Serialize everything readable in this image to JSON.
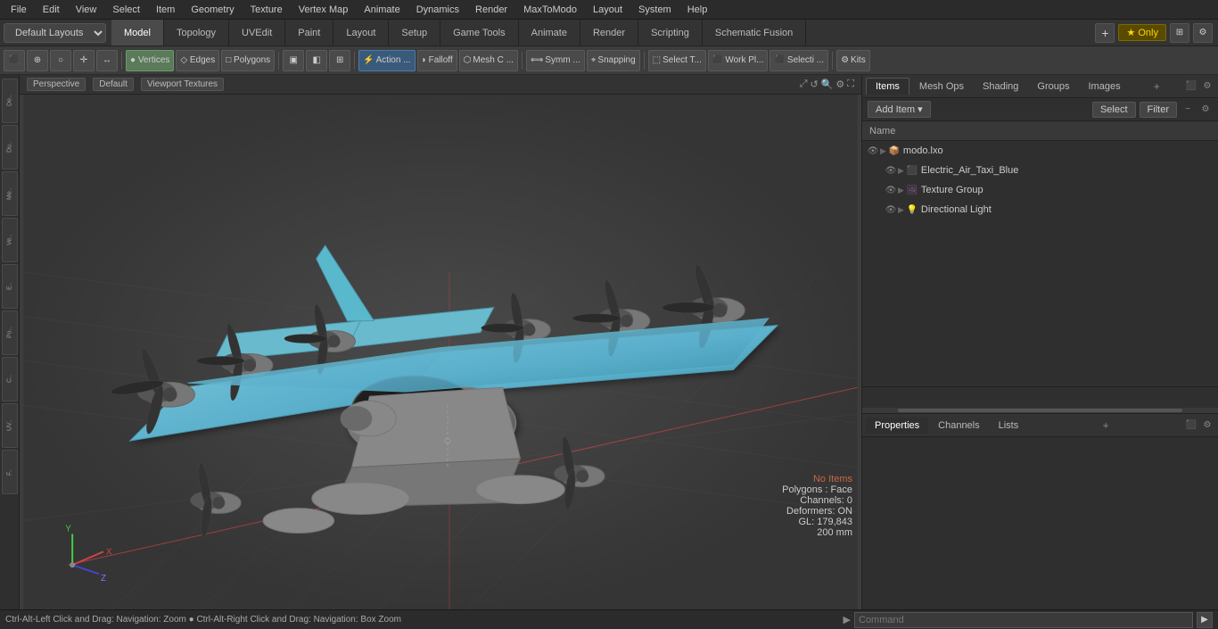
{
  "menu": {
    "items": [
      "File",
      "Edit",
      "View",
      "Select",
      "Item",
      "Geometry",
      "Texture",
      "Vertex Map",
      "Animate",
      "Dynamics",
      "Render",
      "MaxToModo",
      "Layout",
      "System",
      "Help"
    ]
  },
  "layout": {
    "dropdown": "Default Layouts",
    "tabs": [
      "Model",
      "Topology",
      "UVEdit",
      "Paint",
      "Layout",
      "Setup",
      "Game Tools",
      "Animate",
      "Render",
      "Scripting",
      "Schematic Fusion"
    ],
    "active_tab": "Model",
    "star_label": "★ Only",
    "plus_label": "+"
  },
  "toolbar": {
    "component_btns": [
      "▣",
      "⊕",
      "⌀",
      "↕"
    ],
    "mode_btns": [
      "Vertices",
      "Edges",
      "Polygons"
    ],
    "view_btns": [
      "□",
      "◧",
      "⊞"
    ],
    "action_label": "Action ...",
    "falloff_label": "Falloff",
    "mesh_label": "Mesh C ...",
    "symm_label": "Symm ...",
    "snap_label": "Snapping",
    "select_tool_label": "Select T...",
    "workplane_label": "Work Pl...",
    "selecti_label": "Selecti ...",
    "kits_label": "Kits"
  },
  "viewport": {
    "perspective_label": "Perspective",
    "default_label": "Default",
    "textures_label": "Viewport Textures",
    "info": {
      "no_items": "No Items",
      "polygons": "Polygons : Face",
      "channels": "Channels: 0",
      "deformers": "Deformers: ON",
      "gl": "GL: 179,843",
      "size": "200 mm"
    }
  },
  "right_panel": {
    "tabs": [
      "Items",
      "Mesh Ops",
      "Shading",
      "Groups",
      "Images"
    ],
    "active_tab": "Items",
    "items_toolbar": {
      "add_item_label": "Add Item",
      "name_col": "Name",
      "select_btn": "Select",
      "filter_btn": "Filter"
    },
    "tree": [
      {
        "id": 0,
        "level": 0,
        "name": "modo.lxo",
        "icon": "📦",
        "type": "file",
        "expanded": true,
        "eye": true
      },
      {
        "id": 1,
        "level": 1,
        "name": "Electric_Air_Taxi_Blue",
        "icon": "⬛",
        "type": "mesh",
        "expanded": false,
        "eye": true
      },
      {
        "id": 2,
        "level": 1,
        "name": "Texture Group",
        "icon": "🖼",
        "type": "texture",
        "expanded": false,
        "eye": true
      },
      {
        "id": 3,
        "level": 1,
        "name": "Directional Light",
        "icon": "💡",
        "type": "light",
        "expanded": false,
        "eye": true
      }
    ]
  },
  "properties": {
    "tabs": [
      "Properties",
      "Channels",
      "Lists"
    ],
    "active_tab": "Properties",
    "plus_label": "+"
  },
  "bottom": {
    "status": "Ctrl-Alt-Left Click and Drag: Navigation: Zoom  ●  Ctrl-Alt-Right Click and Drag: Navigation: Box Zoom",
    "command_placeholder": "Command",
    "arrow": "▶"
  },
  "left_sidebar": {
    "items": [
      "De...",
      "Du...",
      "Me...",
      "Ve...",
      "E...",
      "Po...",
      "C...",
      "UV...",
      "F..."
    ]
  }
}
